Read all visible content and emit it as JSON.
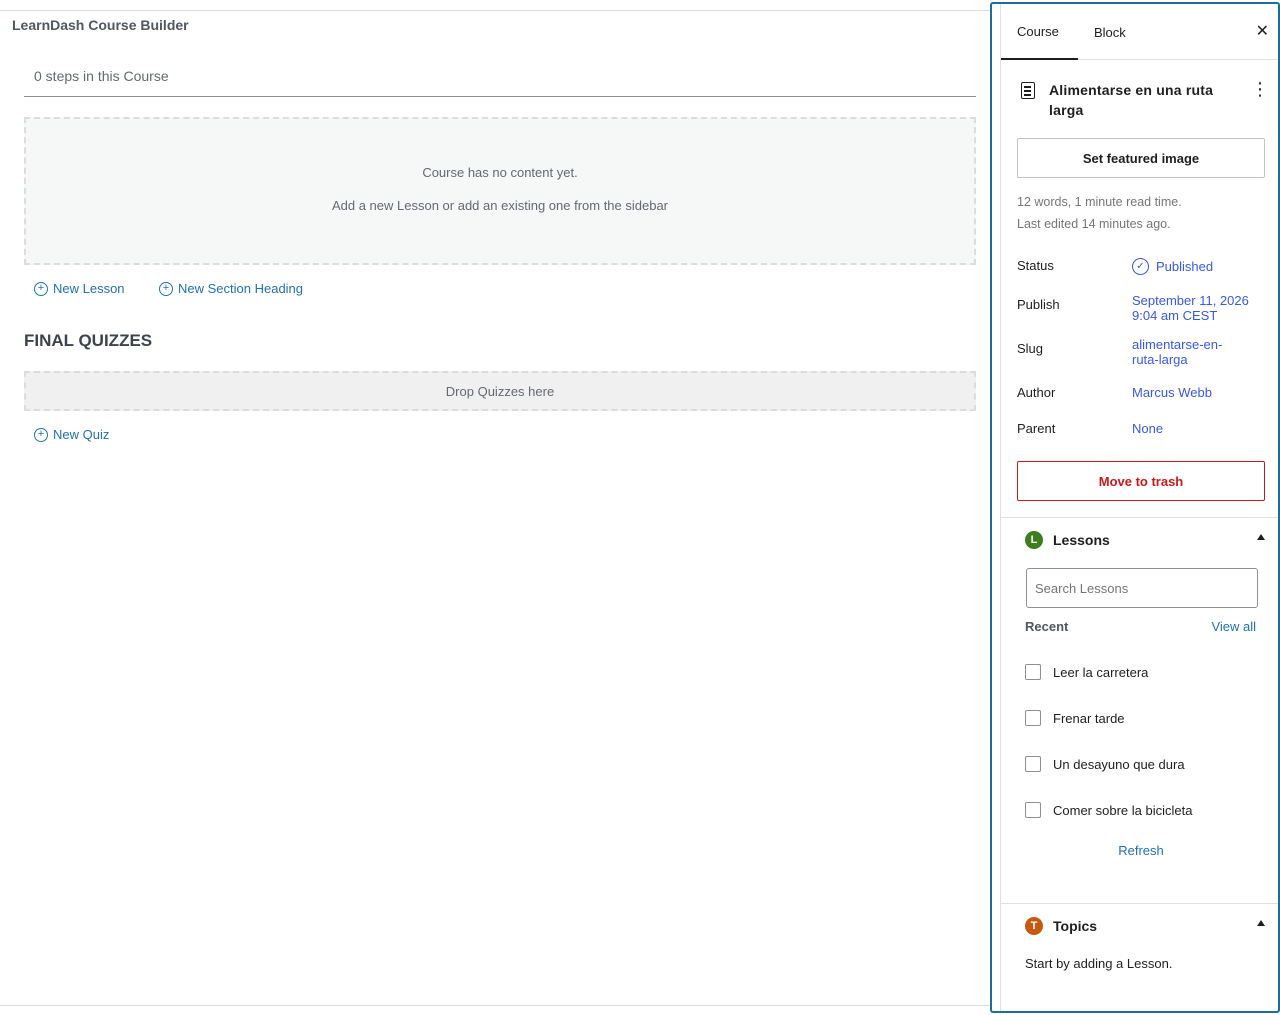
{
  "builder": {
    "title": "LearnDash Course Builder",
    "steps_count": "0 steps in this Course",
    "empty_line1": "Course has no content yet.",
    "empty_line2": "Add a new Lesson or add an existing one from the sidebar",
    "new_lesson": "New Lesson",
    "new_section_heading": "New Section Heading",
    "final_quizzes_title": "FINAL QUIZZES",
    "drop_quizzes": "Drop Quizzes here",
    "new_quiz": "New Quiz"
  },
  "sidebar": {
    "tabs": [
      {
        "label": "Course",
        "active": true
      },
      {
        "label": "Block",
        "active": false
      }
    ],
    "close_icon": "close-icon",
    "post": {
      "title": "Alimentarse en una ruta larga",
      "set_featured_image": "Set featured image",
      "word_count": "12 words, 1 minute read time.",
      "last_edited": "Last edited 14 minutes ago."
    },
    "properties": {
      "status_label": "Status",
      "status_value": "Published",
      "publish_label": "Publish",
      "publish_value": "September 11, 2026 9:04 am CEST",
      "slug_label": "Slug",
      "slug_value": "alimentarse-en-ruta-larga",
      "author_label": "Author",
      "author_value": "Marcus Webb",
      "parent_label": "Parent",
      "parent_value": "None"
    },
    "move_to_trash": "Move to trash",
    "lessons_panel": {
      "badge": "L",
      "title": "Lessons",
      "search_placeholder": "Search Lessons",
      "recent_label": "Recent",
      "view_all": "View all",
      "items": [
        {
          "label": "Leer la carretera",
          "checked": false
        },
        {
          "label": "Frenar tarde",
          "checked": false
        },
        {
          "label": "Un desayuno que dura",
          "checked": false
        },
        {
          "label": "Comer sobre la bicicleta",
          "checked": false
        }
      ],
      "refresh": "Refresh"
    },
    "topics_panel": {
      "badge": "T",
      "title": "Topics",
      "message": "Start by adding a Lesson."
    }
  },
  "colors": {
    "accent_blue": "#2271b1",
    "wp_admin_blue": "#3858e9",
    "danger_red": "#cc1818",
    "lessons_badge": "#3d7d1d",
    "topics_badge": "#c45a10",
    "sidebar_border": "#1e6c9a"
  }
}
